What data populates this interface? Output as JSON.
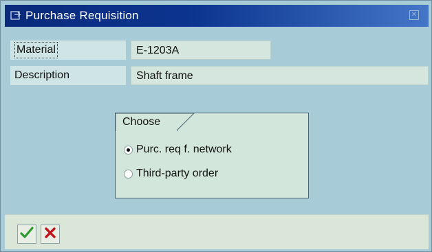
{
  "window": {
    "title": "Purchase Requisition"
  },
  "fields": {
    "material": {
      "label": "Material",
      "value": "E-1203A"
    },
    "description": {
      "label": "Description",
      "value": "Shaft frame"
    }
  },
  "choose_group": {
    "title": "Choose",
    "options": [
      {
        "label": "Purc. req f. network",
        "selected": true
      },
      {
        "label": "Third-party order",
        "selected": false
      }
    ]
  },
  "footer": {
    "confirm_icon": "checkmark-icon",
    "cancel_icon": "cancel-x-icon"
  },
  "colors": {
    "titlebar": "#0c3590",
    "background": "#a8cbd8",
    "confirm": "#2e9a2e",
    "cancel": "#c0141c"
  }
}
